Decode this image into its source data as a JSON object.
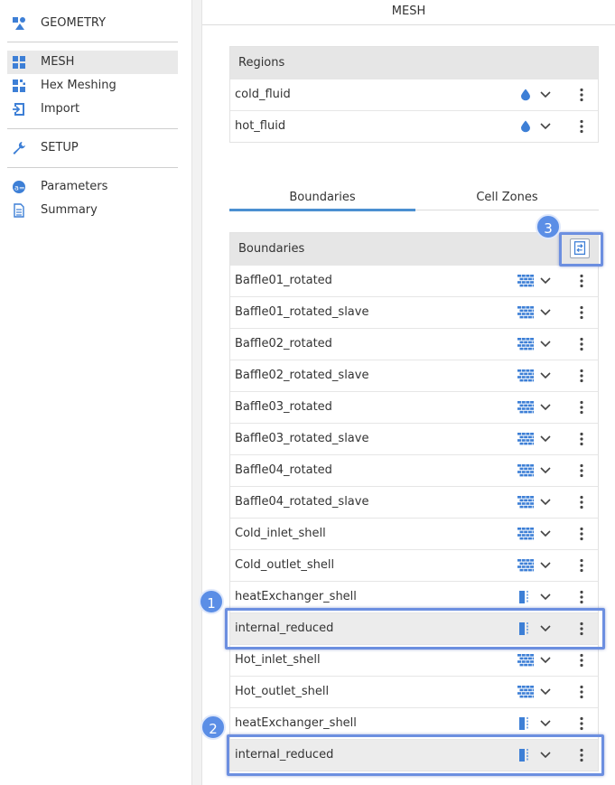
{
  "sidebar": {
    "items": [
      {
        "label": "GEOMETRY",
        "icon": "geometry-icon"
      },
      {
        "label": "MESH",
        "icon": "mesh-icon",
        "active": true
      },
      {
        "label": "Hex Meshing",
        "icon": "hex-meshing-icon"
      },
      {
        "label": "Import",
        "icon": "import-icon"
      },
      {
        "label": "SETUP",
        "icon": "wrench-icon"
      },
      {
        "label": "Parameters",
        "icon": "parameters-icon"
      },
      {
        "label": "Summary",
        "icon": "summary-icon"
      }
    ]
  },
  "main": {
    "title": "MESH",
    "regions": {
      "header": "Regions",
      "rows": [
        {
          "label": "cold_fluid",
          "type": "fluid"
        },
        {
          "label": "hot_fluid",
          "type": "fluid"
        }
      ]
    },
    "tabs": [
      {
        "label": "Boundaries",
        "active": true
      },
      {
        "label": "Cell Zones",
        "active": false
      }
    ],
    "boundaries": {
      "header": "Boundaries",
      "rows": [
        {
          "label": "Baffle01_rotated",
          "type": "wall"
        },
        {
          "label": "Baffle01_rotated_slave",
          "type": "wall"
        },
        {
          "label": "Baffle02_rotated",
          "type": "wall"
        },
        {
          "label": "Baffle02_rotated_slave",
          "type": "wall"
        },
        {
          "label": "Baffle03_rotated",
          "type": "wall"
        },
        {
          "label": "Baffle03_rotated_slave",
          "type": "wall"
        },
        {
          "label": "Baffle04_rotated",
          "type": "wall"
        },
        {
          "label": "Baffle04_rotated_slave",
          "type": "wall"
        },
        {
          "label": "Cold_inlet_shell",
          "type": "wall"
        },
        {
          "label": "Cold_outlet_shell",
          "type": "wall"
        },
        {
          "label": "heatExchanger_shell",
          "type": "interface"
        },
        {
          "label": "internal_reduced",
          "type": "interface",
          "highlight": true
        },
        {
          "label": "Hot_inlet_shell",
          "type": "wall"
        },
        {
          "label": "Hot_outlet_shell",
          "type": "wall"
        },
        {
          "label": "heatExchanger_shell",
          "type": "interface"
        },
        {
          "label": "internal_reduced",
          "type": "interface",
          "highlight": true
        }
      ]
    }
  },
  "callouts": [
    "1",
    "2",
    "3"
  ],
  "colors": {
    "accent": "#4b8fd1",
    "callout": "#5b8ee6",
    "icon_blue": "#3d7fd6"
  }
}
